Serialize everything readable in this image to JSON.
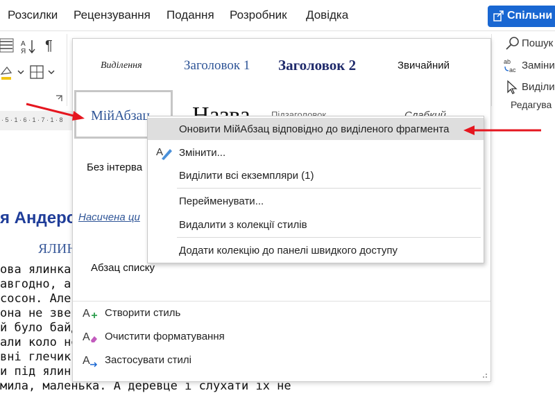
{
  "ribbon_tabs": [
    "Розсилки",
    "Рецензування",
    "Подання",
    "Розробник",
    "Довідка"
  ],
  "share_button": "Спільни",
  "editing_group": {
    "find": "Пошук",
    "replace": "Заміни",
    "select": "Виділи",
    "label": "Редагува"
  },
  "styles_gallery": {
    "row1": [
      "Виділення",
      "Заголовок 1",
      "Заголовок 2",
      "Звичайний"
    ],
    "row2_selected": "МійАбзац",
    "row2_partial": [
      "Назва",
      "Підзаголовок",
      "Слабкий"
    ],
    "no_spacing": "Без інтерва",
    "intense": "Насичена ци",
    "list_paragraph": "Абзац списку"
  },
  "gallery_actions": [
    {
      "label": "Створити стиль",
      "icon": "create-style-icon"
    },
    {
      "label": "Очистити форматування",
      "icon": "clear-formatting-icon"
    },
    {
      "label": "Застосувати стилі",
      "icon": "apply-styles-icon"
    }
  ],
  "context_menu": {
    "items": [
      {
        "label": "Оновити МійАбзац відповідно до виділеного фрагмента",
        "highlighted": true
      },
      {
        "label": "Змінити...",
        "icon": "modify-style-icon"
      },
      {
        "label": "Виділити всі екземпляри (1)"
      },
      {
        "label": "Перейменувати..."
      },
      {
        "label": "Видалити з колекції стилів"
      },
      {
        "label": "Додати колекцію до панелі швидкого доступу"
      }
    ]
  },
  "document": {
    "heading": "я Андерс",
    "subheading": "ЯЛИН",
    "lines": [
      "ова ялинка. М",
      "авгодно, а і",
      "сосон. Але",
      "она не зверт",
      "й було байд",
      "али коло не",
      "вні глечики",
      "и під ялинкою",
      "мила, маленька. А деревце і слухати їх не"
    ]
  },
  "ruler": "· 5 · 1 · 6 · 1 · 7 · 1 · 8",
  "colors": {
    "accent": "#1967d2",
    "heading_blue": "#1f3d99",
    "arrow_red": "#e5161f"
  }
}
